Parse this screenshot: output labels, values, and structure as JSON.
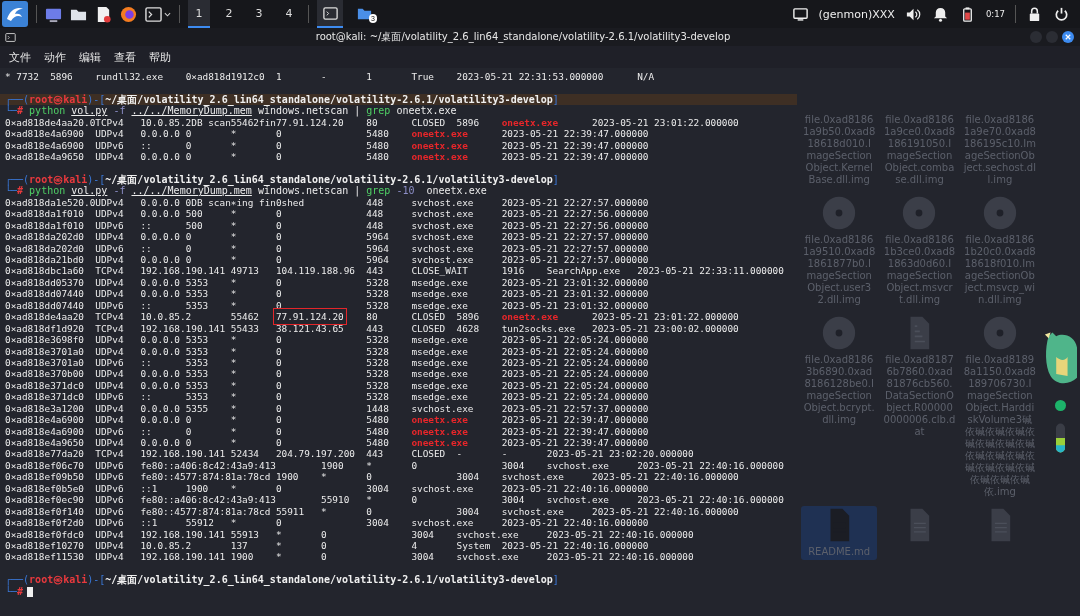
{
  "taskbar": {
    "workspaces": [
      {
        "label": "1",
        "selected": true
      },
      {
        "label": "2",
        "selected": false
      },
      {
        "label": "3",
        "selected": false
      },
      {
        "label": "4",
        "selected": false
      }
    ],
    "windows": [
      {
        "kind": "terminal",
        "selected": true
      },
      {
        "kind": "files",
        "selected": false,
        "badge": "3"
      }
    ],
    "genmon": "(genmon)XXX",
    "clock": "0:17"
  },
  "window": {
    "title": "root@kali: ~/桌面/volatility_2.6_lin64_standalone/volatility-2.6.1/volatility3-develop"
  },
  "menu": [
    "文件",
    "动作",
    "编辑",
    "查看",
    "帮助"
  ],
  "terminal": {
    "lines": [
      {
        "kind": "output",
        "segments": [
          {
            "text": "* 7732\t5896\trundll32.exe\t0×ad818d1912c0\t1\t-\t1\tTrue\t2023-05-21 22:31:53.000000\tN/A",
            "kind": "plain"
          }
        ]
      },
      {
        "kind": "blank"
      },
      {
        "kind": "prompt",
        "highlighted": true,
        "segments": [
          {
            "text": "┌──(",
            "kind": "frame"
          },
          {
            "text": "root㉿kali",
            "kind": "user"
          },
          {
            "text": ")-[",
            "kind": "frame"
          },
          {
            "text": "~/桌面/volatility_2.6_lin64_standalone/volatility-2.6.1/volatility3-develop",
            "kind": "path"
          },
          {
            "text": "]",
            "kind": "frame"
          }
        ]
      },
      {
        "kind": "command",
        "segments": [
          {
            "text": "└─",
            "kind": "frame"
          },
          {
            "text": "# ",
            "kind": "hash"
          },
          {
            "text": "python ",
            "kind": "cmd"
          },
          {
            "text": "vol.py",
            "kind": "file"
          },
          {
            "text": " -f ",
            "kind": "flag"
          },
          {
            "text": "../../MemoryDump.mem",
            "kind": "file"
          },
          {
            "text": " windows.netscan | ",
            "kind": "plain"
          },
          {
            "text": "grep ",
            "kind": "cmd"
          },
          {
            "text": "oneetx.exe",
            "kind": "plain"
          }
        ]
      },
      {
        "kind": "output",
        "segments": [
          {
            "text": "0×ad818de4aa20.0TCPv4\t10.0.85.2DB scan55462fin77.91.124.20\t80\tCLOSED\t5896\t",
            "kind": "plain"
          },
          {
            "text": "oneetx.exe",
            "kind": "red"
          },
          {
            "text": "\t2023-05-21 23:01:22.000000",
            "kind": "plain"
          }
        ]
      },
      {
        "kind": "output",
        "segments": [
          {
            "text": "0×ad818e4a6900\tUDPv4\t0.0.0.0\t0\t*\t0\t\t5480\t",
            "kind": "plain"
          },
          {
            "text": "oneetx.exe",
            "kind": "red"
          },
          {
            "text": "\t2023-05-21 22:39:47.000000",
            "kind": "plain"
          }
        ]
      },
      {
        "kind": "output",
        "segments": [
          {
            "text": "0×ad818e4a6900\tUDPv6\t::\t0\t*\t0\t\t5480\t",
            "kind": "plain"
          },
          {
            "text": "oneetx.exe",
            "kind": "red"
          },
          {
            "text": "\t2023-05-21 22:39:47.000000",
            "kind": "plain"
          }
        ]
      },
      {
        "kind": "output",
        "segments": [
          {
            "text": "0×ad818e4a9650\tUDPv4\t0.0.0.0\t0\t*\t0\t\t5480\t",
            "kind": "plain"
          },
          {
            "text": "oneetx.exe",
            "kind": "red"
          },
          {
            "text": "\t2023-05-21 22:39:47.000000",
            "kind": "plain"
          }
        ]
      },
      {
        "kind": "blank"
      },
      {
        "kind": "prompt",
        "highlighted": false,
        "segments": [
          {
            "text": "┌──(",
            "kind": "frame"
          },
          {
            "text": "root㉿kali",
            "kind": "user"
          },
          {
            "text": ")-[",
            "kind": "frame"
          },
          {
            "text": "~/桌面/volatility_2.6_lin64_standalone/volatility-2.6.1/volatility3-develop",
            "kind": "path"
          },
          {
            "text": "]",
            "kind": "frame"
          }
        ]
      },
      {
        "kind": "command",
        "segments": [
          {
            "text": "└─",
            "kind": "frame"
          },
          {
            "text": "# ",
            "kind": "hash"
          },
          {
            "text": "python ",
            "kind": "cmd"
          },
          {
            "text": "vol.py",
            "kind": "file"
          },
          {
            "text": " -f ",
            "kind": "flag"
          },
          {
            "text": "../../MemoryDump.mem",
            "kind": "file"
          },
          {
            "text": " windows.netscan | ",
            "kind": "plain"
          },
          {
            "text": "grep ",
            "kind": "cmd"
          },
          {
            "text": "-10 ",
            "kind": "flag"
          },
          {
            "text": " oneetx.exe",
            "kind": "plain"
          }
        ]
      },
      {
        "kind": "output",
        "segments": [
          {
            "text": "0×ad818da1e520.0UDPv4\t0.0.0.0 0DB scan∗ing fin0shed\t\t448\tsvchost.exe\t2023-05-21 22:27:57.000000",
            "kind": "plain"
          }
        ]
      },
      {
        "kind": "output",
        "segments": [
          {
            "text": "0×ad818da1f010\tUDPv4\t0.0.0.0\t500\t*\t0\t\t448\tsvchost.exe\t2023-05-21 22:27:56.000000",
            "kind": "plain"
          }
        ]
      },
      {
        "kind": "output",
        "segments": [
          {
            "text": "0×ad818da1f010\tUDPv6\t::\t500\t*\t0\t\t448\tsvchost.exe\t2023-05-21 22:27:56.000000",
            "kind": "plain"
          }
        ]
      },
      {
        "kind": "output",
        "segments": [
          {
            "text": "0×ad818da202d0\tUDPv4\t0.0.0.0\t0\t*\t0\t\t5964\tsvchost.exe\t2023-05-21 22:27:57.000000",
            "kind": "plain"
          }
        ]
      },
      {
        "kind": "output",
        "segments": [
          {
            "text": "0×ad818da202d0\tUDPv6\t::\t0\t*\t0\t\t5964\tsvchost.exe\t2023-05-21 22:27:57.000000",
            "kind": "plain"
          }
        ]
      },
      {
        "kind": "output",
        "segments": [
          {
            "text": "0×ad818da21bd0\tUDPv4\t0.0.0.0\t0\t*\t0\t\t5964\tsvchost.exe\t2023-05-21 22:27:57.000000",
            "kind": "plain"
          }
        ]
      },
      {
        "kind": "output",
        "segments": [
          {
            "text": "0×ad818dbc1a60\tTCPv4\t192.168.190.141\t49713\t104.119.188.96\t443\tCLOSE_WAIT\t1916\tSearchApp.exe\t2023-05-21 22:33:11.000000",
            "kind": "plain"
          }
        ]
      },
      {
        "kind": "output",
        "segments": [
          {
            "text": "0×ad818dd05370\tUDPv4\t0.0.0.0\t5353\t*\t0\t\t5328\tmsedge.exe\t2023-05-21 23:01:32.000000",
            "kind": "plain"
          }
        ]
      },
      {
        "kind": "output",
        "segments": [
          {
            "text": "0×ad818dd07440\tUDPv4\t0.0.0.0\t5353\t*\t0\t\t5328\tmsedge.exe\t2023-05-21 23:01:32.000000",
            "kind": "plain"
          }
        ]
      },
      {
        "kind": "output",
        "segments": [
          {
            "text": "0×ad818dd07440\tUDPv6\t::\t5353\t*\t0\t\t5328\tmsedge.exe\t2023-05-21 23:01:32.000000",
            "kind": "plain"
          }
        ]
      },
      {
        "kind": "output",
        "segments": [
          {
            "text": "0×ad818de4aa20\tTCPv4\t10.0.85.2\t55462\t",
            "kind": "plain"
          },
          {
            "text": "77.91.124.20",
            "kind": "boxed"
          },
          {
            "text": "\t80\tCLOSED\t5896\t",
            "kind": "plain"
          },
          {
            "text": "oneetx.exe",
            "kind": "red"
          },
          {
            "text": "\t2023-05-21 23:01:22.000000",
            "kind": "plain"
          }
        ]
      },
      {
        "kind": "output",
        "segments": [
          {
            "text": "0×ad818df1d920\tTCPv4\t192.168.190.141\t55433\t38.121.43.65\t443\tCLOSED\t4628\ttun2socks.exe\t2023-05-21 23:00:02.000000",
            "kind": "plain"
          }
        ]
      },
      {
        "kind": "output",
        "segments": [
          {
            "text": "0×ad818e3698f0\tUDPv4\t0.0.0.0\t5353\t*\t0\t\t5328\tmsedge.exe\t2023-05-21 22:05:24.000000",
            "kind": "plain"
          }
        ]
      },
      {
        "kind": "output",
        "segments": [
          {
            "text": "0×ad818e3701a0\tUDPv4\t0.0.0.0\t5353\t*\t0\t\t5328\tmsedge.exe\t2023-05-21 22:05:24.000000",
            "kind": "plain"
          }
        ]
      },
      {
        "kind": "output",
        "segments": [
          {
            "text": "0×ad818e3701a0\tUDPv6\t::\t5353\t*\t0\t\t5328\tmsedge.exe\t2023-05-21 22:05:24.000000",
            "kind": "plain"
          }
        ]
      },
      {
        "kind": "output",
        "segments": [
          {
            "text": "0×ad818e370b00\tUDPv4\t0.0.0.0\t5353\t*\t0\t\t5328\tmsedge.exe\t2023-05-21 22:05:24.000000",
            "kind": "plain"
          }
        ]
      },
      {
        "kind": "output",
        "segments": [
          {
            "text": "0×ad818e371dc0\tUDPv4\t0.0.0.0\t5353\t*\t0\t\t5328\tmsedge.exe\t2023-05-21 22:05:24.000000",
            "kind": "plain"
          }
        ]
      },
      {
        "kind": "output",
        "segments": [
          {
            "text": "0×ad818e371dc0\tUDPv6\t::\t5353\t*\t0\t\t5328\tmsedge.exe\t2023-05-21 22:05:24.000000",
            "kind": "plain"
          }
        ]
      },
      {
        "kind": "output",
        "segments": [
          {
            "text": "0×ad818e3a1200\tUDPv4\t0.0.0.0\t5355\t*\t0\t\t1448\tsvchost.exe\t2023-05-21 22:57:37.000000",
            "kind": "plain"
          }
        ]
      },
      {
        "kind": "output",
        "segments": [
          {
            "text": "0×ad818e4a6900\tUDPv4\t0.0.0.0\t0\t*\t0\t\t5480\t",
            "kind": "plain"
          },
          {
            "text": "oneetx.exe",
            "kind": "red"
          },
          {
            "text": "\t2023-05-21 22:39:47.000000",
            "kind": "plain"
          }
        ]
      },
      {
        "kind": "output",
        "segments": [
          {
            "text": "0×ad818e4a6900\tUDPv6\t::\t0\t*\t0\t\t5480\t",
            "kind": "plain"
          },
          {
            "text": "oneetx.exe",
            "kind": "red"
          },
          {
            "text": "\t2023-05-21 22:39:47.000000",
            "kind": "plain"
          }
        ]
      },
      {
        "kind": "output",
        "segments": [
          {
            "text": "0×ad818e4a9650\tUDPv4\t0.0.0.0\t0\t*\t0\t\t5480\t",
            "kind": "plain"
          },
          {
            "text": "oneetx.exe",
            "kind": "red"
          },
          {
            "text": "\t2023-05-21 22:39:47.000000",
            "kind": "plain"
          }
        ]
      },
      {
        "kind": "output",
        "segments": [
          {
            "text": "0×ad818e77da20\tTCPv4\t192.168.190.141\t52434\t204.79.197.200\t443\tCLOSED\t-\t-\t2023-05-21 23:02:20.000000",
            "kind": "plain"
          }
        ]
      },
      {
        "kind": "output",
        "segments": [
          {
            "text": "0×ad818ef06c70\tUDPv6\tfe80::a406:8c42:43a9:413\t1900\t*\t0\t\t3004\tsvchost.exe\t2023-05-21 22:40:16.000000",
            "kind": "plain"
          }
        ]
      },
      {
        "kind": "output",
        "segments": [
          {
            "text": "0×ad818ef09b50\tUDPv6\tfe80::4577:874:81a:78cd 1900\t*\t0\t\t3004\tsvchost.exe\t2023-05-21 22:40:16.000000",
            "kind": "plain"
          }
        ]
      },
      {
        "kind": "output",
        "segments": [
          {
            "text": "0×ad818ef0b5e0\tUDPv6\t::1\t1900\t*\t0\t\t3004\tsvchost.exe\t2023-05-21 22:40:16.000000",
            "kind": "plain"
          }
        ]
      },
      {
        "kind": "output",
        "segments": [
          {
            "text": "0×ad818ef0ec90\tUDPv6\tfe80::a406:8c42:43a9:413\t55910\t*\t0\t\t3004\tsvchost.exe\t2023-05-21 22:40:16.000000",
            "kind": "plain"
          }
        ]
      },
      {
        "kind": "output",
        "segments": [
          {
            "text": "0×ad818ef0f140\tUDPv6\tfe80::4577:874:81a:78cd 55911\t*\t0\t\t3004\tsvchost.exe\t2023-05-21 22:40:16.000000",
            "kind": "plain"
          }
        ]
      },
      {
        "kind": "output",
        "segments": [
          {
            "text": "0×ad818ef0f2d0\tUDPv6\t::1\t55912\t*\t0\t\t3004\tsvchost.exe\t2023-05-21 22:40:16.000000",
            "kind": "plain"
          }
        ]
      },
      {
        "kind": "output",
        "segments": [
          {
            "text": "0×ad818ef0fdc0\tUDPv4\t192.168.190.141\t55913\t*\t0\t\t3004\tsvchost.exe\t2023-05-21 22:40:16.000000",
            "kind": "plain"
          }
        ]
      },
      {
        "kind": "output",
        "segments": [
          {
            "text": "0×ad818ef10270\tUDPv4\t10.0.85.2\t137\t*\t0\t\t4\tSystem\t2023-05-21 22:40:16.000000",
            "kind": "plain"
          }
        ]
      },
      {
        "kind": "output",
        "segments": [
          {
            "text": "0×ad818ef11530\tUDPv4\t192.168.190.141\t1900\t*\t0\t\t3004\tsvchost.exe\t2023-05-21 22:40:16.000000",
            "kind": "plain"
          }
        ]
      },
      {
        "kind": "blank"
      },
      {
        "kind": "prompt",
        "highlighted": false,
        "segments": [
          {
            "text": "┌──(",
            "kind": "frame"
          },
          {
            "text": "root㉿kali",
            "kind": "user"
          },
          {
            "text": ")-[",
            "kind": "frame"
          },
          {
            "text": "~/桌面/volatility_2.6_lin64_standalone/volatility-2.6.1/volatility3-develop",
            "kind": "path"
          },
          {
            "text": "]",
            "kind": "frame"
          }
        ]
      },
      {
        "kind": "input",
        "segments": [
          {
            "text": "└─",
            "kind": "frame"
          },
          {
            "text": "#",
            "kind": "hash"
          }
        ]
      }
    ]
  },
  "desktop": {
    "icons": [
      {
        "kind": "none",
        "selected": false,
        "label": "file.0xad81861a9b50.0xad818618d010.ImageSectionObject.KernelBase.dll.img"
      },
      {
        "kind": "none",
        "selected": false,
        "label": "file.0xad81861a9ce0.0xad8186191050.ImageSectionObject.combase.dll.img"
      },
      {
        "kind": "none",
        "selected": false,
        "label": "file.0xad81861a9e70.0xad8186195c10.ImageSectionObject.sechost.dll.img"
      },
      {
        "kind": "disc",
        "selected": false,
        "label": "file.0xad81861a9510.0xad81861877b0.ImageSectionObject.user32.dll.img"
      },
      {
        "kind": "disc",
        "selected": false,
        "label": "file.0xad81861b3ce0.0xad81863d0d60.ImageSectionObject.msvcrt.dll.img"
      },
      {
        "kind": "disc",
        "selected": false,
        "label": "file.0xad81861b20c0.0xad818618f010.ImageSectionObject.msvcp_win.dll.img"
      },
      {
        "kind": "disc",
        "selected": false,
        "label": "file.0xad81863b6890.0xad8186128be0.ImageSectionObject.bcrypt.dll.img"
      },
      {
        "kind": "binary",
        "selected": false,
        "label": "file.0xad81876b7860.0xad81876cb560.DataSectionObject.R000000000006.clb.dat"
      },
      {
        "kind": "disc",
        "selected": false,
        "label": "file.0xad81898a1150.0xad8189706730.ImageSectionObject.HarddiskVolume3碱依碱依碱依碱依碱依碱依碱依碱依碱依碱依碱依碱依碱依碱依碱依碱依碱依碱依.img"
      },
      {
        "kind": "document",
        "selected": true,
        "label": "README.md"
      },
      {
        "kind": "document",
        "selected": false
      },
      {
        "kind": "document",
        "selected": false
      }
    ]
  }
}
